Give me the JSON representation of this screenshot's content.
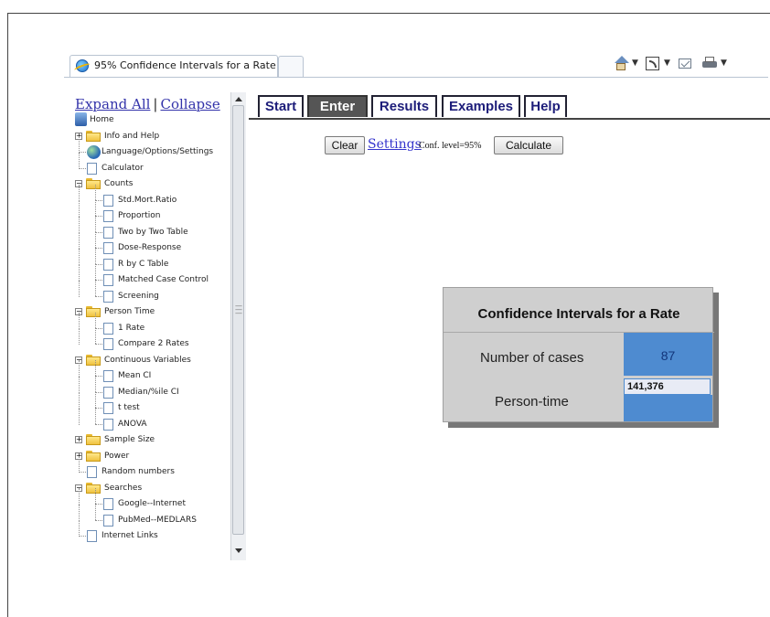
{
  "browser": {
    "tab_title": "95% Confidence Intervals for a Rate"
  },
  "tree": {
    "expand_all": "Expand All",
    "separator": "|",
    "collapse": "Collapse",
    "items": [
      {
        "label": "Home",
        "icon": "home-icon"
      },
      {
        "label": "Info and Help",
        "icon": "folder-icon",
        "toggle": "+"
      },
      {
        "label": "Language/Options/Settings",
        "icon": "globe-icon"
      },
      {
        "label": "Calculator",
        "icon": "page-icon"
      },
      {
        "label": "Counts",
        "icon": "folder-open-icon",
        "toggle": "-"
      },
      {
        "label": "Std.Mort.Ratio",
        "icon": "page-icon"
      },
      {
        "label": "Proportion",
        "icon": "page-icon"
      },
      {
        "label": "Two by Two Table",
        "icon": "page-icon"
      },
      {
        "label": "Dose-Response",
        "icon": "page-icon"
      },
      {
        "label": "R by C Table",
        "icon": "page-icon"
      },
      {
        "label": "Matched Case Control",
        "icon": "page-icon"
      },
      {
        "label": "Screening",
        "icon": "page-icon"
      },
      {
        "label": "Person Time",
        "icon": "folder-open-icon",
        "toggle": "-"
      },
      {
        "label": "1 Rate",
        "icon": "page-icon"
      },
      {
        "label": "Compare 2 Rates",
        "icon": "page-icon"
      },
      {
        "label": "Continuous Variables",
        "icon": "folder-open-icon",
        "toggle": "-"
      },
      {
        "label": "Mean CI",
        "icon": "page-icon"
      },
      {
        "label": "Median/%ile CI",
        "icon": "page-icon"
      },
      {
        "label": "t test",
        "icon": "page-icon"
      },
      {
        "label": "ANOVA",
        "icon": "page-icon"
      },
      {
        "label": "Sample Size",
        "icon": "folder-icon",
        "toggle": "+"
      },
      {
        "label": "Power",
        "icon": "folder-icon",
        "toggle": "+"
      },
      {
        "label": "Random numbers",
        "icon": "page-icon"
      },
      {
        "label": "Searches",
        "icon": "folder-open-icon",
        "toggle": "-"
      },
      {
        "label": "Google--Internet",
        "icon": "page-icon"
      },
      {
        "label": "PubMed--MEDLARS",
        "icon": "page-icon"
      },
      {
        "label": "Internet Links",
        "icon": "page-icon"
      }
    ]
  },
  "app": {
    "tabs": [
      "Start",
      "Enter",
      "Results",
      "Examples",
      "Help"
    ],
    "active_tab": "Enter",
    "clear": "Clear",
    "settings": "Settings",
    "conf_level": "Conf. level=95%",
    "calculate": "Calculate"
  },
  "panel": {
    "title": "Confidence Intervals for a Rate",
    "cases_label": "Number of cases",
    "cases_value": "87",
    "person_time_label": "Person-time",
    "person_time_value": "141,376"
  },
  "colors": {
    "cell_blue": "#4e8bd0",
    "panel_gray": "#cfcfcf",
    "active_tab": "#555555"
  }
}
